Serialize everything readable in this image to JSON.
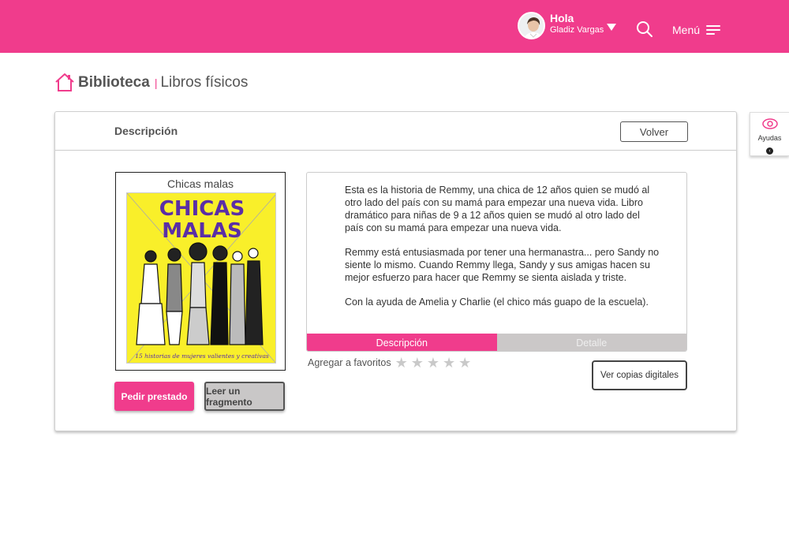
{
  "header": {
    "greeting": "Hola",
    "user_name": "Gladiz Vargas",
    "menu_label": "Menú",
    "accent_color": "#f03c8c"
  },
  "breadcrumb": {
    "title": "Biblioteca",
    "separator": "|",
    "subtitle": "Libros físicos"
  },
  "panel": {
    "title": "Descripción",
    "back_label": "Volver"
  },
  "book": {
    "title": "Chicas malas",
    "cover_title_line1": "CHICAS",
    "cover_title_line2": "MALAS",
    "cover_subtitle": "15 historias de mujeres valientes y creativas"
  },
  "actions": {
    "borrow_label": "Pedir prestado",
    "read_fragment_label": "Leer un fragmento",
    "digital_copies_label": "Ver copias digitales"
  },
  "description": {
    "paragraphs": [
      "Esta es la historia de Remmy, una chica de 12 años quien se mudó al otro lado del país con su mamá para empezar una nueva vida. Libro dramático para niñas de 9 a 12 años quien se mudó al otro lado del país con su mamá para empezar una nueva vida.",
      "Remmy está entusiasmada por tener una hermanastra... pero Sandy no siente lo mismo. Cuando Remmy llega, Sandy y sus amigas hacen su mejor esfuerzo para hacer que Remmy se sienta aislada y triste.",
      "Con la ayuda de Amelia y Charlie (el chico más guapo de la escuela)."
    ],
    "tabs": [
      {
        "label": "Descripción",
        "active": true
      },
      {
        "label": "Detalle",
        "active": false
      }
    ]
  },
  "favorites": {
    "label": "Agregar a favoritos",
    "rating": 0,
    "max_rating": 5
  },
  "help": {
    "label": "Ayudas"
  }
}
